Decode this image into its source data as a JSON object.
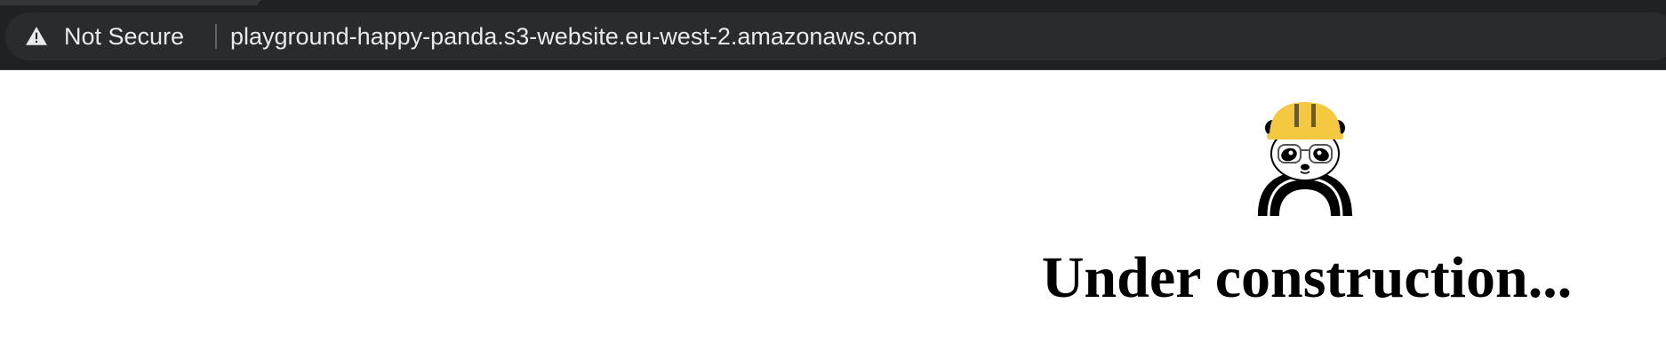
{
  "browser": {
    "security_label": "Not Secure",
    "security_icon": "warning-triangle-icon",
    "url": "playground-happy-panda.s3-website.eu-west-2.amazonaws.com",
    "colors": {
      "toolbar": "#202124",
      "omnibox": "#2a2b2e",
      "text": "#e8eaed"
    }
  },
  "page": {
    "logo_icon": "construction-panda-icon",
    "heading": "Under construction...",
    "colors": {
      "helmet": "#f5c842",
      "background": "#ffffff"
    }
  }
}
